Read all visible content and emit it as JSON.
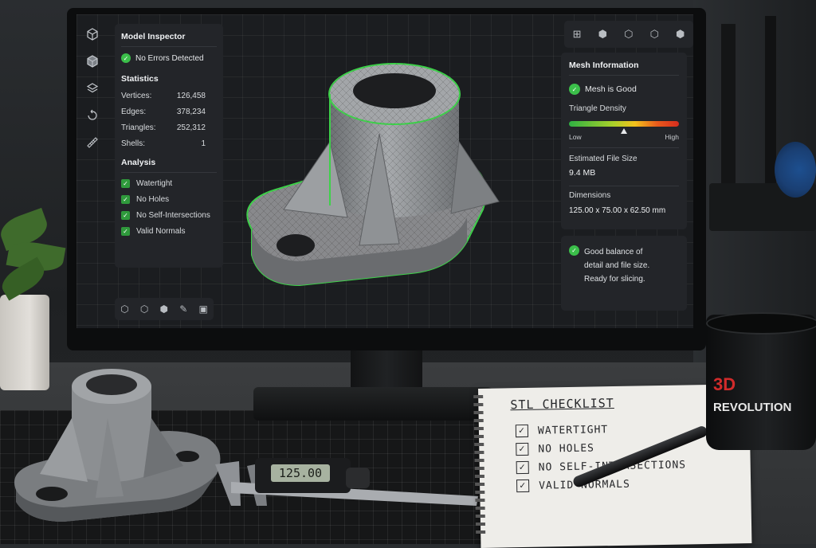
{
  "app": {
    "left_toolbar": [
      "cube-icon",
      "solid-cube-icon",
      "layers-icon",
      "rotate-icon",
      "ruler-icon"
    ],
    "inspector": {
      "title": "Model Inspector",
      "status": "No Errors Detected",
      "statistics_heading": "Statistics",
      "stats": [
        {
          "label": "Vertices:",
          "value": "126,458"
        },
        {
          "label": "Edges:",
          "value": "378,234"
        },
        {
          "label": "Triangles:",
          "value": "252,312"
        },
        {
          "label": "Shells:",
          "value": "1"
        }
      ],
      "analysis_heading": "Analysis",
      "analysis": [
        "Watertight",
        "No Holes",
        "No Self-Intersections",
        "Valid Normals"
      ]
    },
    "bottom_toolbar": [
      "cube-icon",
      "cube-outline-icon",
      "cube-shaded-icon",
      "wand-icon",
      "frame-icon"
    ],
    "right_toolbar": [
      "grid-select-icon",
      "solid-cube-icon",
      "cube-outline-icon",
      "settings-cube-icon",
      "render-cube-icon"
    ],
    "mesh_info": {
      "title": "Mesh Information",
      "status": "Mesh is Good",
      "density_label": "Triangle Density",
      "density_low": "Low",
      "density_high": "High",
      "density_level": 0.5,
      "file_size_label": "Estimated File Size",
      "file_size": "9.4 MB",
      "dimensions_label": "Dimensions",
      "dimensions": "125.00 x 75.00 x 62.50 mm"
    },
    "summary": {
      "line1": "Good balance of",
      "line2": "detail and file size.",
      "line3": "Ready for slicing."
    },
    "colors": {
      "accent_green": "#3bbf4a",
      "panel": "#232529"
    }
  },
  "desk": {
    "caliper_reading": "125.00",
    "notebook": {
      "title": "STL CHECKLIST",
      "items": [
        "WATERTIGHT",
        "NO HOLES",
        "NO SELF-INTERSECTIONS",
        "VALID NORMALS"
      ]
    },
    "mug": {
      "logo_top": "3D",
      "logo_bottom": "REVOLUTION"
    }
  }
}
